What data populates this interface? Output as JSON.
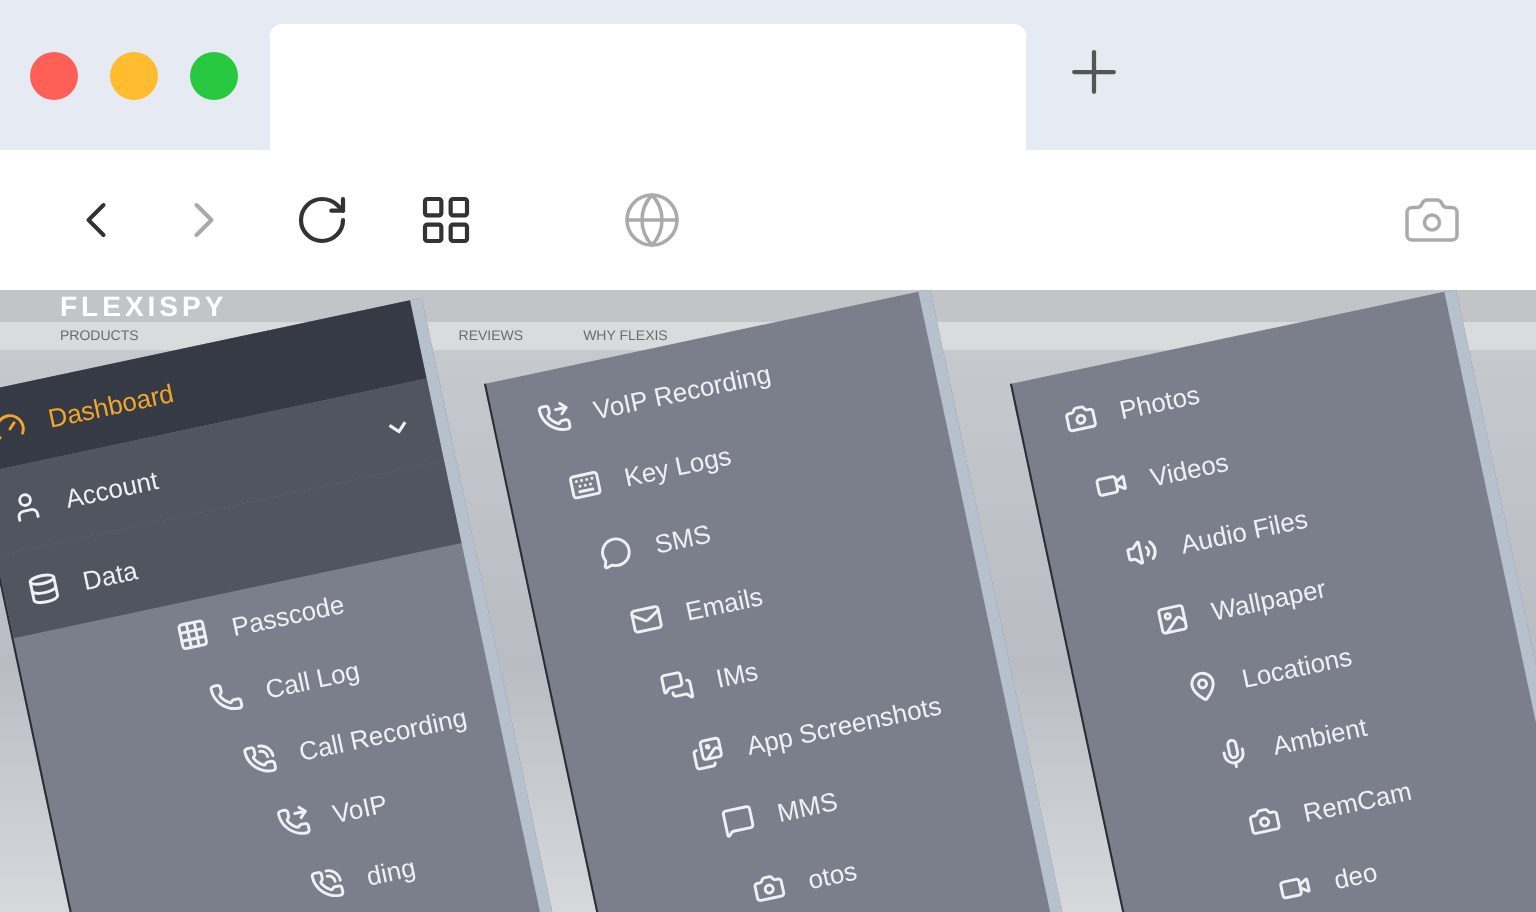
{
  "website": {
    "logo": "FLEXISPY",
    "nav": [
      "PRODUCTS",
      "REVIEWS",
      "WHY FLEXIS"
    ]
  },
  "panels": [
    {
      "items": [
        {
          "label": "Dashboard",
          "kind": "header"
        },
        {
          "label": "Account",
          "kind": "section",
          "expanded": false
        },
        {
          "label": "Data",
          "kind": "section"
        },
        {
          "label": "Passcode",
          "kind": "item"
        },
        {
          "label": "Call Log",
          "kind": "item"
        },
        {
          "label": "Call Recording",
          "kind": "item"
        },
        {
          "label": "VoIP",
          "kind": "item"
        },
        {
          "label": "ding",
          "kind": "item"
        }
      ]
    },
    {
      "items": [
        {
          "label": "VoIP Recording",
          "kind": "item"
        },
        {
          "label": "Key Logs",
          "kind": "item"
        },
        {
          "label": "SMS",
          "kind": "item"
        },
        {
          "label": "Emails",
          "kind": "item"
        },
        {
          "label": "IMs",
          "kind": "item"
        },
        {
          "label": "App Screenshots",
          "kind": "item"
        },
        {
          "label": "MMS",
          "kind": "item"
        },
        {
          "label": "otos",
          "kind": "item"
        }
      ]
    },
    {
      "items": [
        {
          "label": "Photos",
          "kind": "item"
        },
        {
          "label": "Videos",
          "kind": "item"
        },
        {
          "label": "Audio Files",
          "kind": "item"
        },
        {
          "label": "Wallpaper",
          "kind": "item"
        },
        {
          "label": "Locations",
          "kind": "item"
        },
        {
          "label": "Ambient",
          "kind": "item"
        },
        {
          "label": "RemCam",
          "kind": "item"
        },
        {
          "label": "deo",
          "kind": "item"
        }
      ]
    }
  ]
}
